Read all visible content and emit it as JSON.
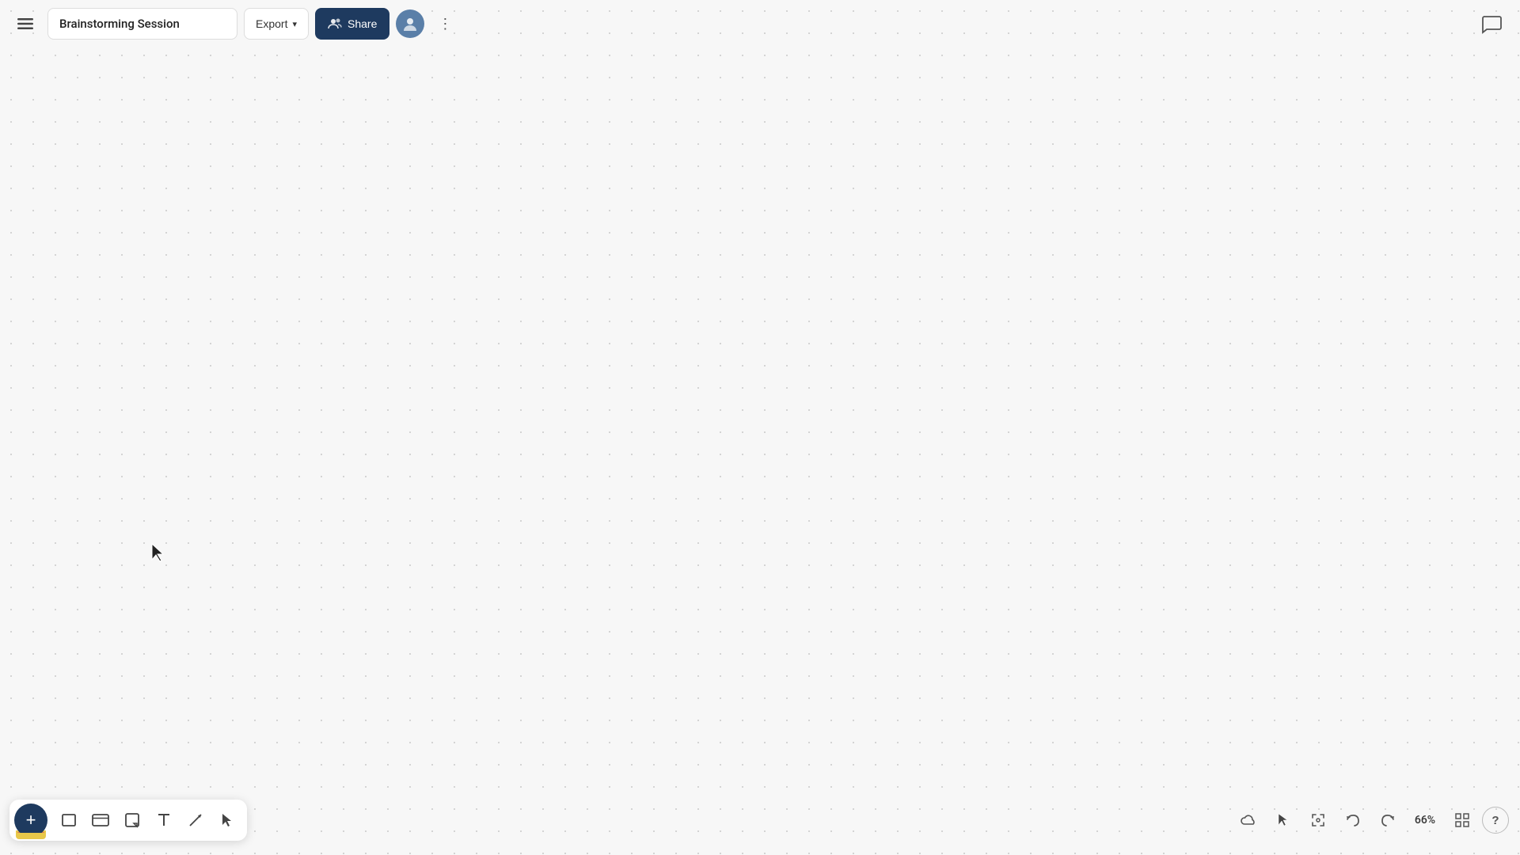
{
  "header": {
    "menu_label": "☰",
    "title": "Brainstorming Session",
    "export_label": "Export",
    "export_chevron": "▾",
    "share_label": "Share",
    "more_label": "⋮"
  },
  "toolbar": {
    "add_label": "+",
    "tools": [
      {
        "name": "rectangle-tool",
        "icon": "□",
        "label": "Rectangle"
      },
      {
        "name": "card-tool",
        "icon": "▭",
        "label": "Card"
      },
      {
        "name": "note-tool",
        "icon": "⬛",
        "label": "Sticky Note"
      },
      {
        "name": "text-tool",
        "icon": "T",
        "label": "Text"
      },
      {
        "name": "line-tool",
        "icon": "↗",
        "label": "Line"
      },
      {
        "name": "pointer-tool",
        "icon": "▲",
        "label": "Pointer"
      }
    ]
  },
  "bottom_right": {
    "cloud_icon": "☁",
    "cursor_icon": "↖",
    "move_icon": "⊕",
    "undo_icon": "↩",
    "redo_icon": "↪",
    "zoom_level": "66%",
    "grid_icon": "▦",
    "help_icon": "?"
  },
  "chat_icon": "💬",
  "colors": {
    "primary": "#1e3a5f",
    "background": "#f7f7f7",
    "dot": "#c8c8c8"
  }
}
